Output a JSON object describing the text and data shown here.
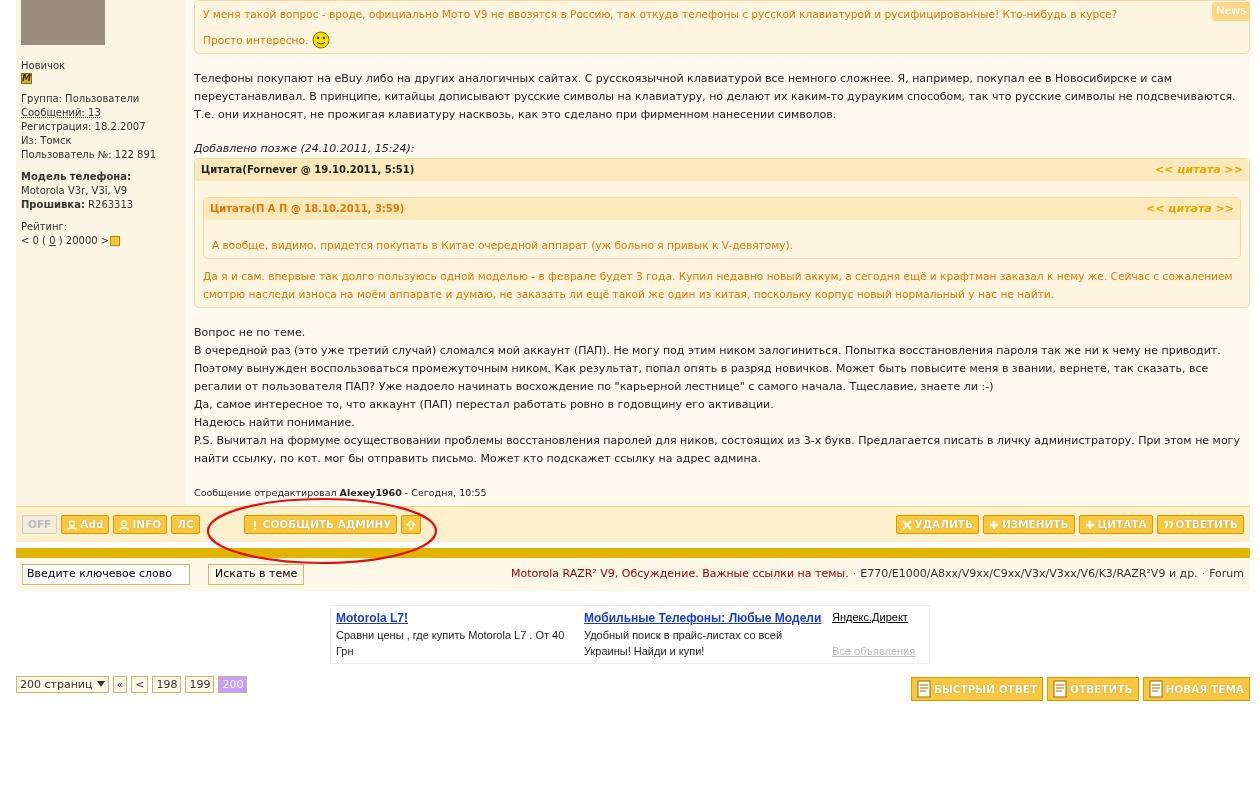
{
  "news_tab": "News",
  "profile": {
    "rank": "Новичок",
    "badge": "M",
    "lines": [
      "Группа: Пользователи",
      "Сообщений: 13",
      "Регистрация: 18.2.2007",
      "Из: Томск",
      "Пользователь №: 122 891"
    ],
    "phone_model_label": "Модель телефона:",
    "phone_model": "Motorola V3r, V3i, V9",
    "firmware_label": "Прошивка:",
    "firmware": "R263313",
    "rating_label": "Рейтинг:",
    "rating_before": "< 0 (",
    "rating_value": "0",
    "rating_after": ") 20000 >"
  },
  "post": {
    "top_quote_lines": [
      "У меня такой вопрос - вроде, официально Мото V9 не ввозятся в Россию, так откуда телефоны с русской клавиатурой и русифицированные! Кто-нибудь в курсе?",
      "Просто интересно."
    ],
    "paragraph": "Телефоны покупают на eBuy либо на других аналогичных сайтах. С русскоязычной клавиатурой все немного сложнее. Я, например, покупал ее в Новосибирске и сам переустанавливал. В принципе, китайцы дописывают русские символы на клавиатуру, но делают их каким-то дурауким способом, так что русские символы не подсвечиваются. Т.е. они ихнаносят, не прожигая клавиатуру насквозь, как это сделано при фирменном нанесении символов.",
    "added_later": "Добавлено позже (24.10.2011, 15:24):",
    "quote": {
      "header": "Цитата(Fornever @ 19.10.2011, 5:51)",
      "link": "<< цитата >>",
      "inner": {
        "header": "Цитата(П А П @ 18.10.2011, 3:59)",
        "link": "<< цитата >>",
        "text": "А вообще, видимо, придется покупать в Китае очередной аппарат (уж больно я привык к V-девятому)."
      },
      "text": "Да я и сам. впервые так долго пользуюсь одной моделью - в феврале будет 3 года. Купил недавно новый аккум, а сегодня ещё и крафтман заказал к нему же. Сейчас с сожалением смотрю наследи износа на моём аппарате и думаю, не заказать ли ещё такой же один из китая, поскольку корпус новый нормальный у нас не найти."
    },
    "message_lines": [
      "Вопрос не по теме.",
      "В очередной раз (это уже третий случай) сломался мой аккаунт (ПАП). Не могу под этим ником залогиниться. Попытка восстановления пароля так же ни к чему не приводит. Поэтому вынужден воспользоваться промежуточным ником. Как результат, попал опять в разряд новичков. Может быть повысите меня в звании, вернете, так сказать, все регалии от пользователя ПАП? Уже надоело начинать восхождение по \"карьерной лестнице\" с самого начала. Тщеславие, знаете ли :-)",
      "Да, самое интересное то, что аккаунт (ПАП) перестал работать ровно в годовщину его активации.",
      "Надеюсь найти понимание.",
      "P.S. Вычитал на формуме осуществовании проблемы восстановления паролей для ников, состоящих из 3-х букв. Предлагается писать в личку администратору. При этом не могу найти ссылку, по кот. мог бы отправить письмо. Может кто подскажет ссылку на адрес админа."
    ],
    "edit_note": "Сообщение отредактировал **Alexey1960** - Сегодня, 10:55"
  },
  "user_buttons": [
    {
      "label": "OFF",
      "kind": "status"
    },
    {
      "label": "Add",
      "kind": "person"
    },
    {
      "label": "INFO",
      "kind": "person"
    },
    {
      "label": "ЛС",
      "kind": "plain"
    }
  ],
  "report_buttons": [
    {
      "label": "СООБЩИТЬ АДМИНУ",
      "kind": "alert"
    },
    {
      "kind": "up"
    }
  ],
  "action_buttons": [
    {
      "label": "УДАЛИТЬ",
      "kind": "delete"
    },
    {
      "label": "ИЗМЕНИТЬ",
      "kind": "plus"
    },
    {
      "label": "ЦИТАТА",
      "kind": "plus"
    },
    {
      "label": "ОТВЕТИТЬ",
      "kind": "quote"
    }
  ],
  "search": {
    "value": "Введите ключевое слово",
    "button": "Искать в теме"
  },
  "breadcrumbs": {
    "separator": "·",
    "items": [
      "Motorola RAZR² V9, Обсуждение. Важные ссылки на темы.",
      "E770/E1000/A8xx/V9xx/C9xx/V3x/V3xx/V6/K3/RAZR²V9 и др.",
      "Forum"
    ]
  },
  "ads": {
    "items": [
      {
        "title": "Motorola L7!",
        "text": "Сравни цены , где купить Motorola L7 . От 40 Грн"
      },
      {
        "title": "Мобильные Телефоны: Любые Модели",
        "text": "Удобный поиск в прайс-листах со всей Украины! Найди и купи!"
      }
    ],
    "provider": "Яндекс.Директ",
    "all_link": "Все объявления"
  },
  "pagination": {
    "dropdown": "200 страниц",
    "first": "«",
    "prev": "<",
    "pages": [
      {
        "label": "198",
        "selected": false
      },
      {
        "label": "199",
        "selected": false
      },
      {
        "label": "200",
        "selected": true
      }
    ]
  },
  "bottom_buttons": [
    "БЫСТРЫЙ ОТВЕТ",
    "ОТВЕТИТЬ",
    "НОВАЯ ТЕМА"
  ]
}
